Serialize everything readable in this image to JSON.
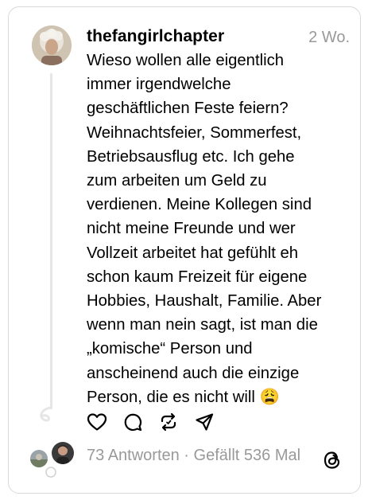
{
  "post": {
    "username": "thefangirlchapter",
    "time": "2 Wo.",
    "lines": [
      "Wieso wollen alle eigentlich",
      "immer irgendwelche",
      "geschäftlichen Feste feiern?",
      "Weihnachtsfeier, Sommerfest,",
      "Betriebsausflug etc. Ich gehe",
      "zum arbeiten um Geld zu",
      "verdienen. Meine Kollegen sind",
      "nicht meine Freunde und wer",
      "Vollzeit arbeitet hat gefühlt eh",
      "schon kaum Freizeit für eigene",
      "Hobbies, Haushalt, Familie. Aber",
      "wenn man nein sagt, ist man die",
      "„komische“ Person und",
      "anscheinend auch die einzige",
      "Person, die es nicht will 😩"
    ]
  },
  "actions": {
    "like_icon": "heart-icon",
    "comment_icon": "comment-icon",
    "repost_icon": "repost-icon",
    "share_icon": "send-icon"
  },
  "stats": {
    "replies": "73 Antworten",
    "separator": " · ",
    "likes": "Gefällt 536 Mal"
  },
  "colors": {
    "text": "#000000",
    "secondary": "#999999",
    "border": "#d9d9d9",
    "thread_line": "#e6e6e6"
  }
}
